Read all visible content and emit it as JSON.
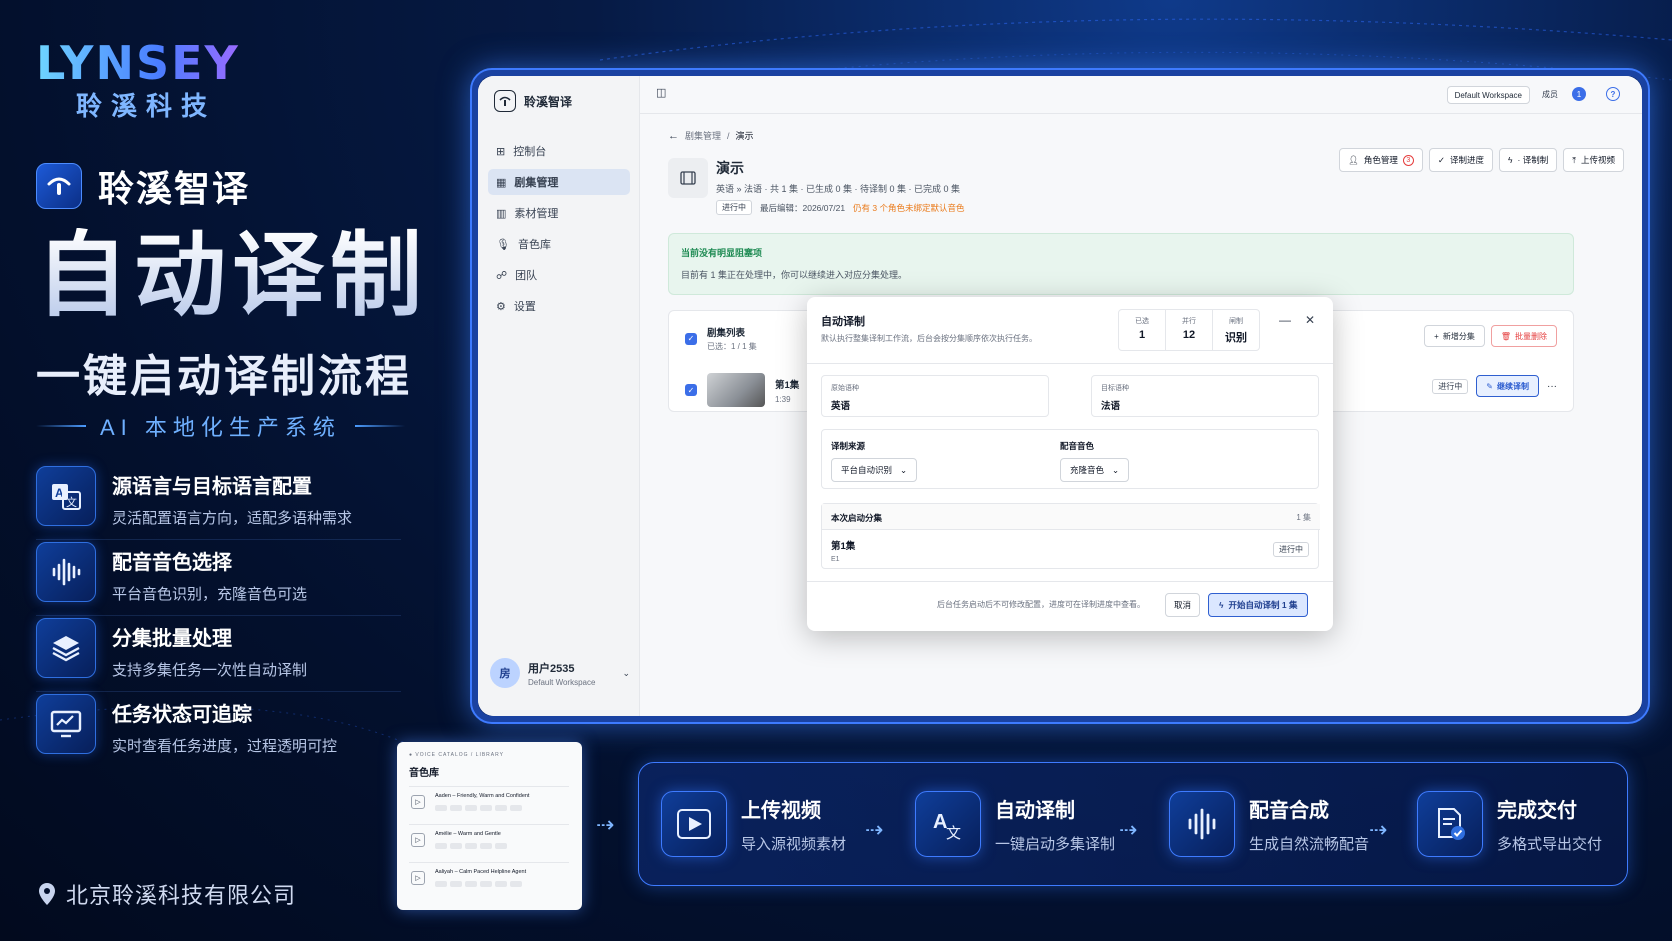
{
  "brand": {
    "logo": "LYNSEY",
    "logo_cn": "聆溪科技",
    "app_name": "聆溪智译"
  },
  "hero": {
    "title": "自动译制",
    "subtitle": "一键启动译制流程",
    "tagline": "AI 本地化生产系统"
  },
  "features": [
    {
      "icon": "translate-icon",
      "title": "源语言与目标语言配置",
      "desc": "灵活配置语言方向，适配多语种需求"
    },
    {
      "icon": "waveform-icon",
      "title": "配音音色选择",
      "desc": "平台音色识别，充隆音色可选"
    },
    {
      "icon": "layers-icon",
      "title": "分集批量处理",
      "desc": "支持多集任务一次性自动译制"
    },
    {
      "icon": "monitor-chart-icon",
      "title": "任务状态可追踪",
      "desc": "实时查看任务进度，过程透明可控"
    }
  ],
  "company": "北京聆溪科技有限公司",
  "app": {
    "sidebar": {
      "brand": "聆溪智译",
      "items": [
        {
          "icon": "dashboard-icon",
          "label": "控制台"
        },
        {
          "icon": "grid-icon",
          "label": "剧集管理",
          "active": true
        },
        {
          "icon": "columns-icon",
          "label": "素材管理"
        },
        {
          "icon": "mic-icon",
          "label": "音色库"
        },
        {
          "icon": "team-icon",
          "label": "团队"
        },
        {
          "icon": "settings-icon",
          "label": "设置"
        }
      ],
      "user": {
        "avatar": "房",
        "name": "用户2535",
        "workspace": "Default Workspace"
      }
    },
    "topbar": {
      "workspace": "Default Workspace",
      "member": "成员",
      "bell": "1",
      "help": "?"
    },
    "breadcrumb": {
      "parent": "剧集管理",
      "sep": "/",
      "current": "演示"
    },
    "project": {
      "title": "演示",
      "meta": "英语 » 法语 · 共 1 集 · 已生成 0 集 · 待译制 0 集 · 已完成 0 集",
      "status": "进行中",
      "edited": "最后编辑：2026/07/21",
      "warning": "仍有 3 个角色未绑定默认音色"
    },
    "actions": [
      {
        "icon": "user-icon",
        "label": "角色管理",
        "badge": "3"
      },
      {
        "icon": "check-icon",
        "label": "译制进度"
      },
      {
        "icon": "bolt-icon",
        "label": "· 译制制"
      },
      {
        "icon": "upload-icon",
        "label": "上传视频"
      }
    ],
    "notice": {
      "title": "当前没有明显阻塞项",
      "desc": "目前有 1 集正在处理中，你可以继续进入对应分集处理。"
    },
    "episodes": {
      "title": "剧集列表",
      "selected": "已选：1 / 1 集",
      "add": "新增分集",
      "delete": "批量删除",
      "rows": [
        {
          "name": "第1集",
          "duration": "1:39",
          "status": "进行中",
          "action": "继续译制",
          "more": "···"
        }
      ]
    },
    "dialog": {
      "title": "自动译制",
      "subtitle": "默认执行整集译制工作流，后台会按分集顺序依次执行任务。",
      "stats": [
        {
          "label": "已选",
          "value": "1"
        },
        {
          "label": "并行",
          "value": "12"
        },
        {
          "label": "闸制",
          "value": "识别"
        }
      ],
      "source_label": "原始语种",
      "source": "英语",
      "target_label": "目标语种",
      "target": "法语",
      "mode_label": "译制来源",
      "mode": "平台自动识别",
      "voice_label": "配音音色",
      "voice": "充隆音色",
      "batch_label": "本次启动分集",
      "batch_count": "1 集",
      "batch_item": "第1集",
      "batch_code": "E1",
      "batch_status": "进行中",
      "footnote": "后台任务启动后不可修改配置，进度可在译制进度中查看。",
      "cancel": "取消",
      "start": "开始自动译制 1 集"
    }
  },
  "voice_card": {
    "caption": "● VOICE CATALOG / LIBRARY",
    "title": "音色库",
    "items": [
      "Aaden – Friendly, Warm and Confident",
      "Amélie – Warm and Gentle",
      "Aaliyah – Calm Paced Helpline Agent"
    ]
  },
  "workflow": [
    {
      "icon": "play-icon",
      "title": "上传视频",
      "desc": "导入源视频素材"
    },
    {
      "icon": "translate-icon",
      "title": "自动译制",
      "desc": "一键启动多集译制"
    },
    {
      "icon": "waveform-icon",
      "title": "配音合成",
      "desc": "生成自然流畅配音"
    },
    {
      "icon": "document-check-icon",
      "title": "完成交付",
      "desc": "多格式导出交付"
    }
  ]
}
